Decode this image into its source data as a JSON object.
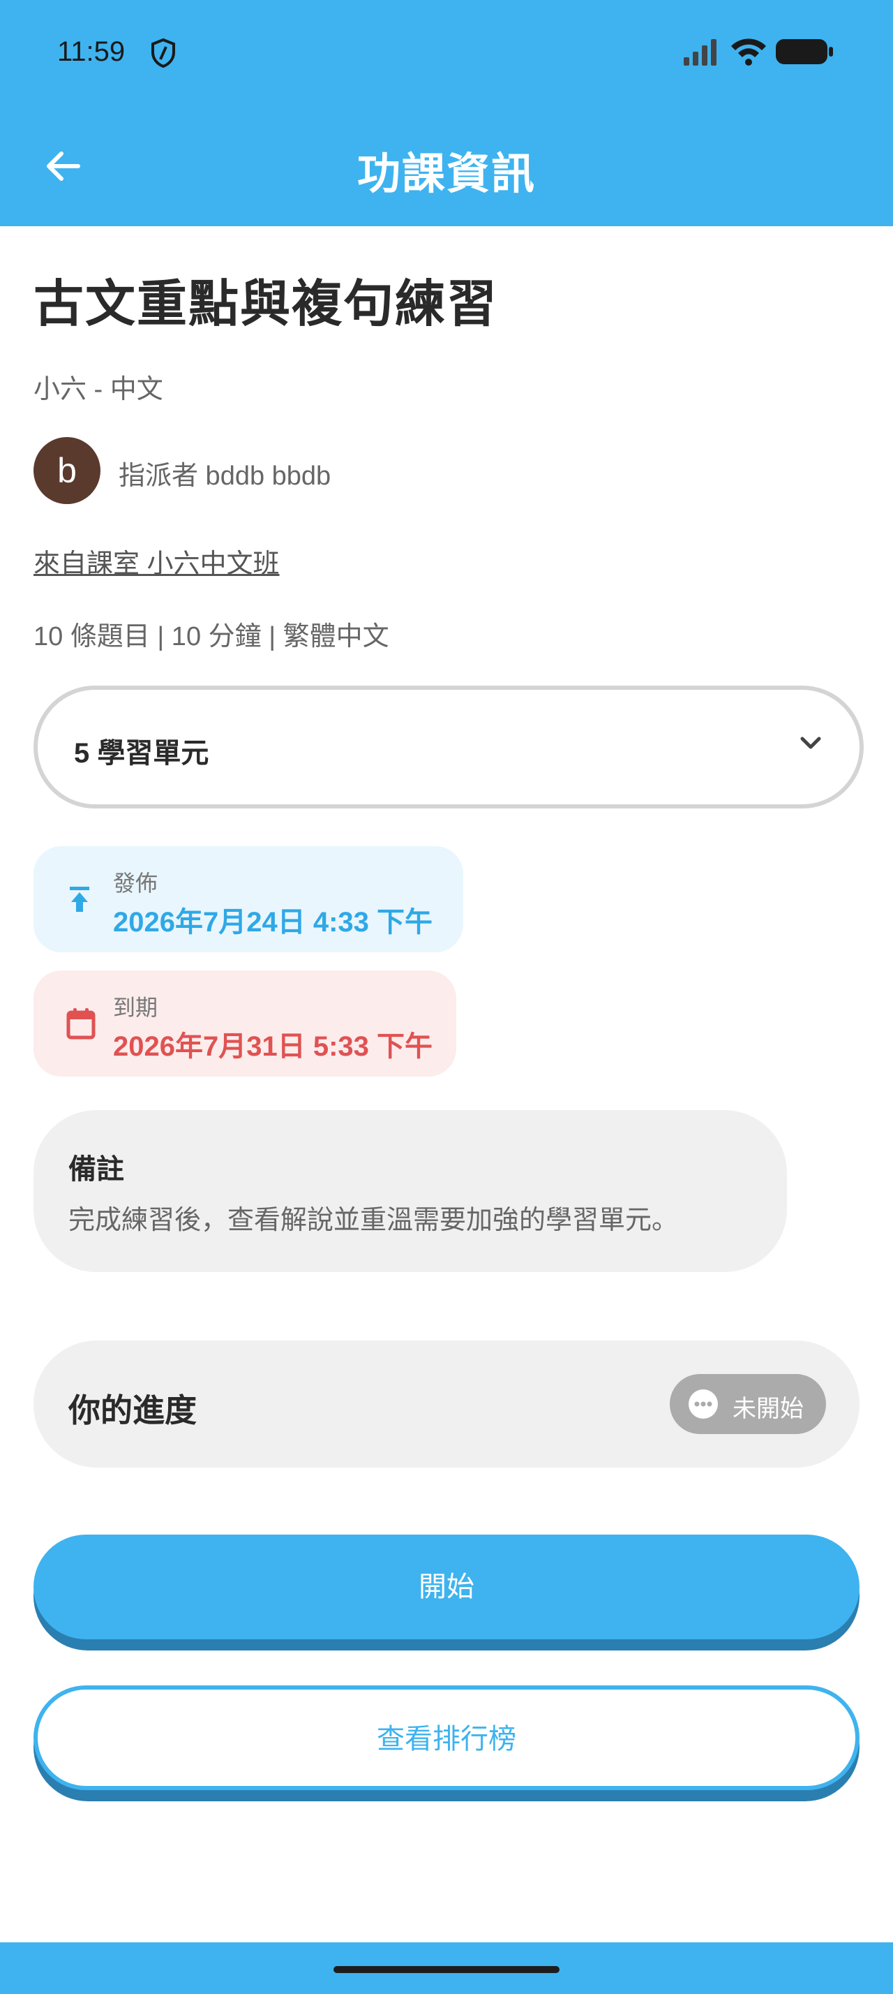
{
  "status": {
    "time": "11:59"
  },
  "header": {
    "title": "功課資訊"
  },
  "assignment": {
    "title": "古文重點與複句練習",
    "subject": "小六 - 中文",
    "avatar_letter": "b",
    "assigned_by": "指派者 bddb bbdb",
    "classroom": "來自課室 小六中文班",
    "meta": "10 條題目 | 10 分鐘 | 繁體中文"
  },
  "units": {
    "label": "5 學習單元"
  },
  "publish": {
    "label": "發佈",
    "value": "2026年7月24日 4:33 下午",
    "color": "#2fa8e6"
  },
  "due": {
    "label": "到期",
    "value": "2026年7月31日 5:33 下午",
    "color": "#e05252"
  },
  "notes": {
    "title": "備註",
    "text": "完成練習後，查看解說並重溫需要加強的學習單元。"
  },
  "progress": {
    "label": "你的進度",
    "status": "未開始"
  },
  "actions": {
    "start": "開始",
    "leaderboard": "查看排行榜"
  }
}
